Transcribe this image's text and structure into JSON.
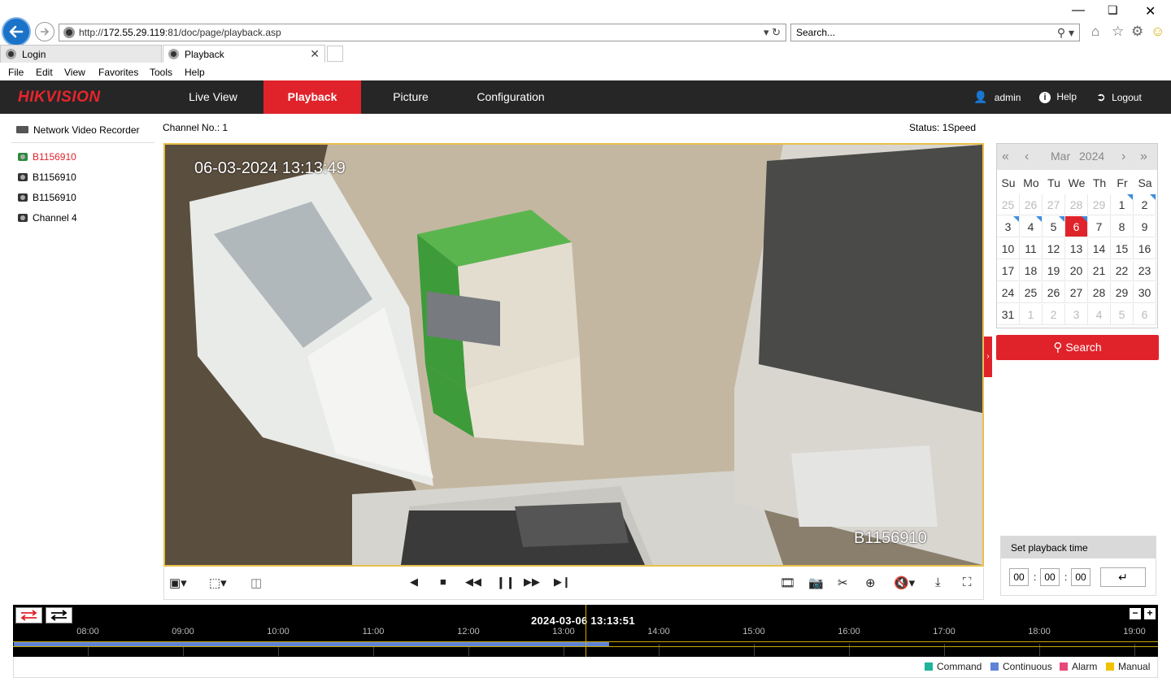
{
  "browser": {
    "url_prefix": "http://",
    "url_host": "172.55.29.119",
    "url_rest": ":81/doc/page/playback.asp",
    "search_placeholder": "Search...",
    "tabs": [
      {
        "label": "Login"
      },
      {
        "label": "Playback"
      }
    ],
    "menu": [
      "File",
      "Edit",
      "View",
      "Favorites",
      "Tools",
      "Help"
    ]
  },
  "app": {
    "logo": "HIKVISION",
    "nav": [
      "Live View",
      "Playback",
      "Picture",
      "Configuration"
    ],
    "user": "admin",
    "help": "Help",
    "logout": "Logout"
  },
  "tree": {
    "root": "Network Video Recorder",
    "channels": [
      "B1156910",
      "B1156910",
      "B1156910",
      "Channel 4"
    ]
  },
  "player": {
    "channel_label": "Channel No.: 1",
    "status_label": "Status: 1Speed",
    "osd_datetime": "06-03-2024 13:13:49",
    "osd_name": "B1156910"
  },
  "calendar": {
    "month": "Mar",
    "year": "2024",
    "weekdays": [
      "Su",
      "Mo",
      "Tu",
      "We",
      "Th",
      "Fr",
      "Sa"
    ],
    "selected_day": 6,
    "search_label": "Search"
  },
  "playback_time": {
    "title": "Set playback time",
    "hh": "00",
    "mm": "00",
    "ss": "00"
  },
  "timeline": {
    "current": "2024-03-06 13:13:51",
    "hours": [
      "08:00",
      "09:00",
      "10:00",
      "11:00",
      "12:00",
      "13:00",
      "14:00",
      "15:00",
      "16:00",
      "17:00",
      "18:00",
      "19:00"
    ],
    "record_progress": 0.52
  },
  "legend": [
    {
      "label": "Command",
      "color": "#1fb39a"
    },
    {
      "label": "Continuous",
      "color": "#5f84d6"
    },
    {
      "label": "Alarm",
      "color": "#e8487a"
    },
    {
      "label": "Manual",
      "color": "#f2c200"
    }
  ],
  "colors": {
    "accent": "#e0232b",
    "header_bg": "#262626"
  }
}
